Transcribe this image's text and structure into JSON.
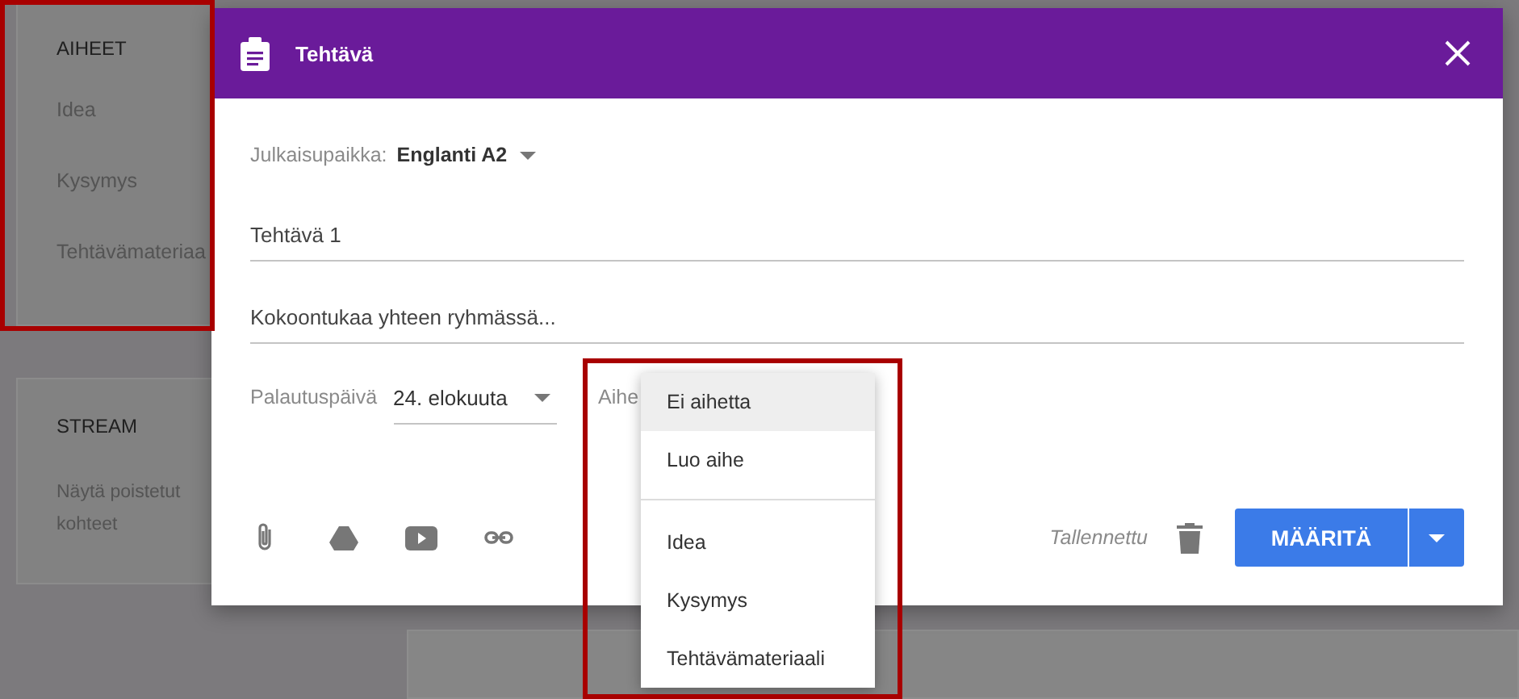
{
  "sidebar": {
    "topics_card": {
      "heading": "AIHEET",
      "items": [
        "Idea",
        "Kysymys",
        "Tehtävämateriaa"
      ]
    },
    "stream_card": {
      "heading": "STREAM",
      "link": "Näytä poistetut kohteet"
    }
  },
  "dialog": {
    "title": "Tehtävä",
    "post_to_label": "Julkaisupaikka:",
    "post_to_value": "Englanti A2",
    "title_field": {
      "value": "Tehtävä 1"
    },
    "instructions_field": {
      "value": "Kokoontukaa yhteen ryhmässä..."
    },
    "due_label": "Palautuspäivä",
    "due_value": "24. elokuuta",
    "topic_label": "Aihe",
    "saved_status": "Tallennettu",
    "assign_button": "MÄÄRITÄ"
  },
  "topic_menu": {
    "sections": [
      {
        "items": [
          {
            "label": "Ei aihetta",
            "selected": true
          },
          {
            "label": "Luo aihe",
            "selected": false
          }
        ]
      },
      {
        "items": [
          {
            "label": "Idea",
            "selected": false
          },
          {
            "label": "Kysymys",
            "selected": false
          },
          {
            "label": "Tehtävämateriaali",
            "selected": false
          }
        ]
      }
    ]
  }
}
